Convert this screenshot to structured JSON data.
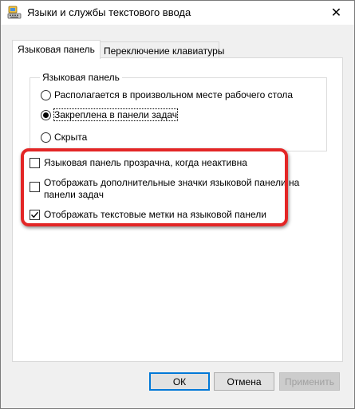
{
  "window": {
    "title": "Языки и службы текстового ввода",
    "close_glyph": "✕"
  },
  "tabs": [
    {
      "label": "Языковая панель",
      "active": true
    },
    {
      "label": "Переключение клавиатуры",
      "active": false
    }
  ],
  "language_bar_group": {
    "legend": "Языковая панель",
    "options": [
      {
        "label": "Располагается в произвольном месте рабочего стола",
        "checked": false
      },
      {
        "label": "Закреплена в панели задач",
        "checked": true
      },
      {
        "label": "Скрыта",
        "checked": false
      }
    ]
  },
  "checkboxes": [
    {
      "label": "Языковая панель прозрачна, когда неактивна",
      "checked": false
    },
    {
      "label_line1": "Отображать дополнительные значки языковой панели на",
      "label_line2": "панели задач",
      "checked": false
    },
    {
      "label": "Отображать текстовые метки на языковой панели",
      "checked": true
    }
  ],
  "buttons": {
    "ok": "ОК",
    "cancel": "Отмена",
    "apply": "Применить"
  },
  "colors": {
    "highlight_border": "#e32626",
    "default_button_border": "#0078d7"
  }
}
